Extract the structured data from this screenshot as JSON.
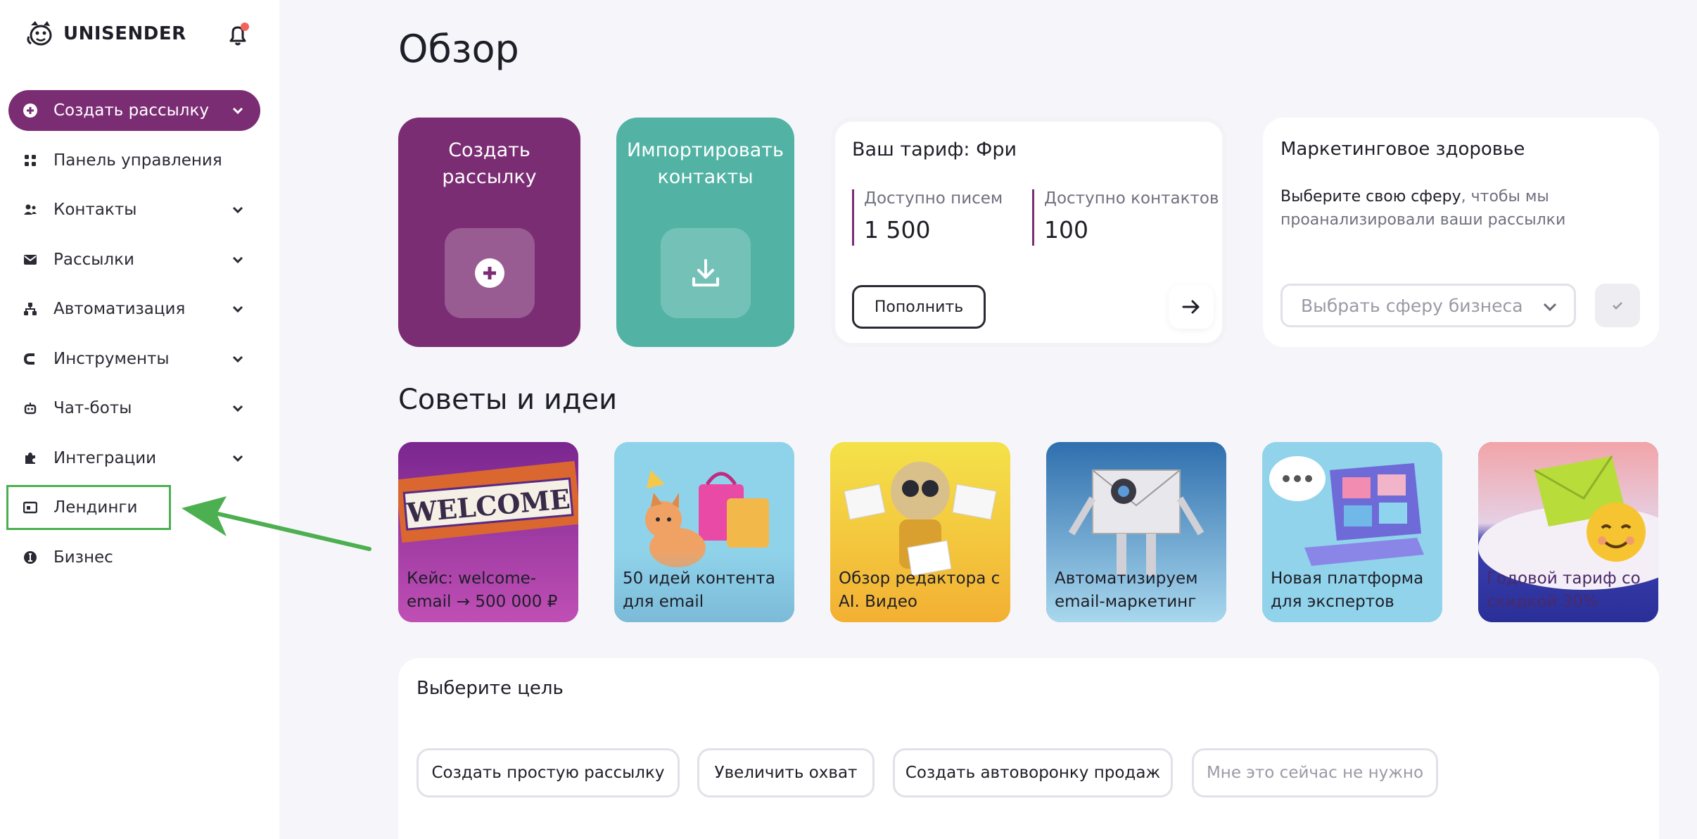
{
  "brand": {
    "name": "UNISENDER"
  },
  "sidebar": {
    "items": [
      {
        "label": "Создать рассылку",
        "icon": "plus-circle-icon"
      },
      {
        "label": "Панель управления",
        "icon": "grid-icon"
      },
      {
        "label": "Контакты",
        "icon": "users-icon"
      },
      {
        "label": "Рассылки",
        "icon": "mail-icon"
      },
      {
        "label": "Автоматизация",
        "icon": "flow-icon"
      },
      {
        "label": "Инструменты",
        "icon": "magnet-icon"
      },
      {
        "label": "Чат-боты",
        "icon": "robot-icon"
      },
      {
        "label": "Интеграции",
        "icon": "puzzle-icon"
      },
      {
        "label": "Лендинги",
        "icon": "landing-icon"
      },
      {
        "label": "Бизнес",
        "icon": "business-icon"
      }
    ]
  },
  "main": {
    "title": "Обзор",
    "create_card": {
      "title": "Создать рассылку"
    },
    "import_card": {
      "title": "Импортировать контакты"
    },
    "tariff": {
      "title": "Ваш тариф: Фри",
      "emails_label": "Доступно писем",
      "emails_value": "1 500",
      "contacts_label": "Доступно контактов",
      "contacts_value": "100",
      "topup_label": "Пополнить"
    },
    "health": {
      "title": "Маркетинговое здоровье",
      "desc_dark": "Выберите свою сферу",
      "desc_rest": ", чтобы мы проанализировали ваши рассылки",
      "select_placeholder": "Выбрать сферу бизнеса"
    },
    "tips_title": "Советы и идеи",
    "tips": [
      {
        "label": "Кейс: welcome-email → 500 000 ₽"
      },
      {
        "label": "50 идей контента для email"
      },
      {
        "label": "Обзор редактора с AI. Видео"
      },
      {
        "label": "Автоматизируем email-маркетинг"
      },
      {
        "label": "Новая платформа для экспертов"
      },
      {
        "label": "Годовой тариф со скидкой 30%"
      }
    ],
    "welcome_sign": "WELCOME",
    "goal": {
      "title": "Выберите цель",
      "buttons": [
        "Создать простую рассылку",
        "Увеличить охват",
        "Создать автоворонку продаж",
        "Мне это сейчас не нужно"
      ]
    }
  },
  "colors": {
    "brand_purple": "#7b2d74",
    "teal": "#52b3a5",
    "highlight_green": "#4caf50"
  }
}
